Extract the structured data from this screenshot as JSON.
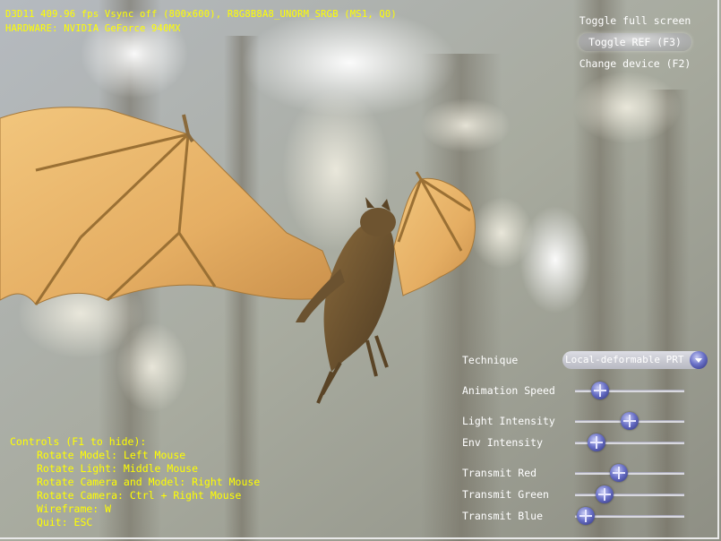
{
  "stats": {
    "line1": "D3D11 409.96 fps Vsync off (800x600), R8G8B8A8_UNORM_SRGB (MS1, Q0)",
    "line2": "HARDWARE: NVIDIA GeForce 940MX"
  },
  "hud": {
    "toggle_fullscreen": "Toggle full screen",
    "toggle_ref": "Toggle REF (F3)",
    "change_device": "Change device (F2)"
  },
  "controls": {
    "technique_label": "Technique",
    "technique_value": "Local-deformable PRT",
    "animation_speed_label": "Animation Speed",
    "animation_speed_value": 0.23,
    "light_intensity_label": "Light Intensity",
    "light_intensity_value": 0.5,
    "env_intensity_label": "Env Intensity",
    "env_intensity_value": 0.2,
    "transmit_red_label": "Transmit Red",
    "transmit_red_value": 0.4,
    "transmit_green_label": "Transmit Green",
    "transmit_green_value": 0.27,
    "transmit_blue_label": "Transmit Blue",
    "transmit_blue_value": 0.1
  },
  "help": {
    "title": "Controls (F1 to hide):",
    "lines": [
      "Rotate Model: Left Mouse",
      "Rotate Light: Middle Mouse",
      "Rotate Camera and Model: Right Mouse",
      "Rotate Camera: Ctrl + Right Mouse",
      "Wireframe: W",
      "Quit: ESC"
    ]
  },
  "colors": {
    "stat_text": "#ffff00",
    "hud_text": "#ffffff",
    "slider_thumb": "#5a61c0",
    "wing": "#e8b56a"
  }
}
